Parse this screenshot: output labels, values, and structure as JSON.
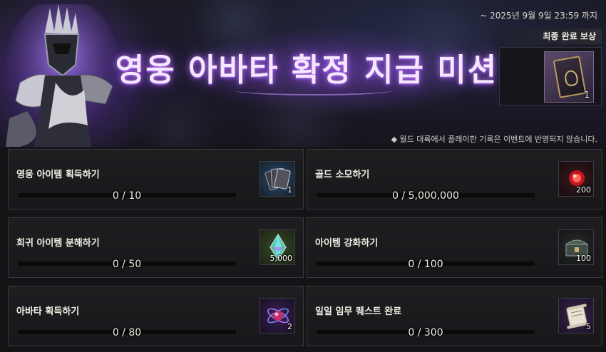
{
  "banner": {
    "title": "영웅 아바타 확정 지급 미션",
    "deadline": "~ 2025년 9월 9일 23:59 까지",
    "final_reward_label": "최종 완료 보상",
    "final_reward_qty": "1",
    "final_reward_icon": "avatar-card-icon",
    "notice": "◆ 월드 대륙에서 플레이한 기록은 이벤트에 반영되지 않습니다."
  },
  "missions": [
    {
      "label": "영웅 아이템 획득하기",
      "progress_text": "0 / 10",
      "progress": 0,
      "reward_qty": "1",
      "reward_icon": "card-pack-icon"
    },
    {
      "label": "골드 소모하기",
      "progress_text": "0 / 5,000,000",
      "progress": 0,
      "reward_qty": "200",
      "reward_icon": "red-orb-icon"
    },
    {
      "label": "희귀 아이템 분해하기",
      "progress_text": "0 / 50",
      "progress": 0,
      "reward_qty": "5,000",
      "reward_icon": "crystal-icon"
    },
    {
      "label": "아이템 강화하기",
      "progress_text": "0 / 100",
      "progress": 0,
      "reward_qty": "100",
      "reward_icon": "chest-icon"
    },
    {
      "label": "아바타 획득하기",
      "progress_text": "0 / 80",
      "progress": 0,
      "reward_qty": "2",
      "reward_icon": "purple-orb-icon"
    },
    {
      "label": "일일 임무 퀘스트 완료",
      "progress_text": "0 / 300",
      "progress": 0,
      "reward_qty": "5",
      "reward_icon": "scroll-icon"
    }
  ],
  "colors": {
    "progress_fill": "#d7b46a",
    "title_glow": "#a060ff"
  }
}
